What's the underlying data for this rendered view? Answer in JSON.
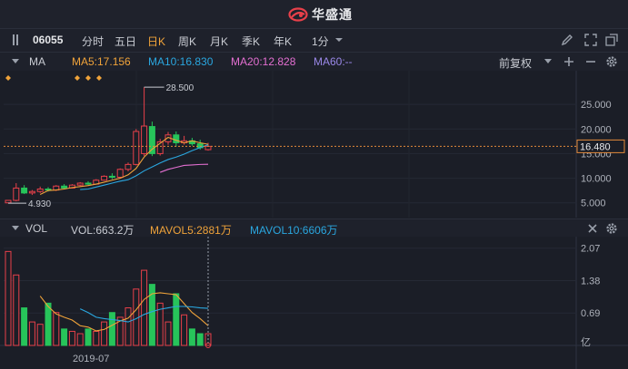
{
  "app": {
    "brand": "华盛通"
  },
  "toolbar": {
    "code": "06055",
    "periods": [
      "分时",
      "五日",
      "日K",
      "周K",
      "月K",
      "季K",
      "年K"
    ],
    "active_period": "日K",
    "interval": "1分"
  },
  "ma_bar": {
    "label": "MA",
    "ma5": "MA5:17.156",
    "ma10": "MA10:16.830",
    "ma20": "MA20:12.828",
    "ma60": "MA60:--",
    "adjust": "前复权",
    "colors": {
      "ma5": "#f0a33a",
      "ma10": "#2aa7e0",
      "ma20": "#e36fd1",
      "ma60": "#9a88e8",
      "up": "#e8404a",
      "down": "#27c45a"
    }
  },
  "price_axis": {
    "ticks": [
      "25.000",
      "20.000",
      "15.000",
      "10.000",
      "5.000"
    ],
    "current_price": "16.480",
    "high_label": "28.500",
    "low_label": "4.930"
  },
  "vol_bar": {
    "label": "VOL",
    "vol": "VOL:663.2万",
    "mavol5": "MAVOL5:2881万",
    "mavol10": "MAVOL10:6606万"
  },
  "vol_axis": {
    "ticks": [
      "2.07",
      "1.38",
      "0.69"
    ],
    "unit": "亿"
  },
  "x_axis": {
    "date_label": "2019-07"
  },
  "chart_data": {
    "type": "candlestick",
    "note_unit": "price HKD, volume 亿",
    "candles": [
      {
        "o": 5.0,
        "h": 5.6,
        "l": 4.93,
        "c": 5.5,
        "v": 2.0
      },
      {
        "o": 5.5,
        "h": 9.0,
        "l": 5.3,
        "c": 8.0,
        "v": 1.5
      },
      {
        "o": 8.0,
        "h": 8.6,
        "l": 6.8,
        "c": 7.0,
        "v": 0.8
      },
      {
        "o": 7.0,
        "h": 7.6,
        "l": 6.6,
        "c": 7.3,
        "v": 0.5
      },
      {
        "o": 7.3,
        "h": 8.3,
        "l": 7.0,
        "c": 7.8,
        "v": 0.45
      },
      {
        "o": 7.8,
        "h": 8.2,
        "l": 7.3,
        "c": 7.6,
        "v": 0.9
      },
      {
        "o": 7.6,
        "h": 8.6,
        "l": 7.4,
        "c": 8.4,
        "v": 0.7
      },
      {
        "o": 8.4,
        "h": 8.8,
        "l": 7.8,
        "c": 8.0,
        "v": 0.35
      },
      {
        "o": 8.0,
        "h": 8.8,
        "l": 7.9,
        "c": 8.6,
        "v": 0.3
      },
      {
        "o": 8.6,
        "h": 9.2,
        "l": 8.4,
        "c": 9.0,
        "v": 0.25
      },
      {
        "o": 9.0,
        "h": 9.4,
        "l": 8.6,
        "c": 8.8,
        "v": 0.35
      },
      {
        "o": 8.8,
        "h": 9.8,
        "l": 8.7,
        "c": 9.6,
        "v": 0.3
      },
      {
        "o": 9.6,
        "h": 10.6,
        "l": 9.5,
        "c": 10.4,
        "v": 0.5
      },
      {
        "o": 10.4,
        "h": 11.0,
        "l": 9.8,
        "c": 10.2,
        "v": 0.7
      },
      {
        "o": 10.2,
        "h": 12.0,
        "l": 10.0,
        "c": 11.8,
        "v": 0.6
      },
      {
        "o": 11.8,
        "h": 13.2,
        "l": 11.4,
        "c": 12.8,
        "v": 0.8
      },
      {
        "o": 12.8,
        "h": 20.0,
        "l": 12.6,
        "c": 19.5,
        "v": 1.2
      },
      {
        "o": 15.0,
        "h": 28.5,
        "l": 14.5,
        "c": 20.6,
        "v": 1.6
      },
      {
        "o": 20.5,
        "h": 21.5,
        "l": 14.5,
        "c": 15.0,
        "v": 1.3
      },
      {
        "o": 15.0,
        "h": 18.0,
        "l": 14.6,
        "c": 17.4,
        "v": 0.9
      },
      {
        "o": 17.4,
        "h": 19.4,
        "l": 16.8,
        "c": 18.8,
        "v": 0.5
      },
      {
        "o": 18.8,
        "h": 19.5,
        "l": 16.4,
        "c": 17.2,
        "v": 1.1
      },
      {
        "o": 17.2,
        "h": 18.6,
        "l": 16.8,
        "c": 17.6,
        "v": 0.65
      },
      {
        "o": 17.6,
        "h": 18.2,
        "l": 16.6,
        "c": 17.0,
        "v": 0.35
      },
      {
        "o": 17.0,
        "h": 17.8,
        "l": 15.8,
        "c": 16.2,
        "v": 0.25
      },
      {
        "o": 15.8,
        "h": 17.2,
        "l": 15.6,
        "c": 16.48,
        "v": 0.25
      }
    ],
    "ma5": [
      null,
      null,
      null,
      null,
      6.7,
      7.5,
      7.6,
      7.8,
      8.1,
      8.3,
      8.5,
      8.8,
      9.2,
      9.6,
      10.0,
      10.7,
      12.0,
      14.3,
      15.9,
      17.1,
      18.3,
      17.7,
      17.2,
      17.6,
      17.2,
      16.9
    ],
    "ma10": [
      null,
      null,
      null,
      null,
      null,
      null,
      null,
      null,
      null,
      7.7,
      7.8,
      8.2,
      8.6,
      9.0,
      9.4,
      9.7,
      10.5,
      11.5,
      12.3,
      13.1,
      13.8,
      14.3,
      14.9,
      15.6,
      16.2,
      16.8
    ],
    "ma20": [
      null,
      null,
      null,
      null,
      null,
      null,
      null,
      null,
      null,
      null,
      null,
      null,
      null,
      null,
      null,
      null,
      null,
      null,
      null,
      11.2,
      11.8,
      12.2,
      12.6,
      12.7,
      12.8,
      12.83
    ],
    "mavol5": [
      null,
      null,
      null,
      null,
      1.05,
      0.83,
      0.67,
      0.6,
      0.54,
      0.42,
      0.39,
      0.31,
      0.34,
      0.43,
      0.52,
      0.58,
      0.76,
      0.98,
      1.1,
      1.12,
      1.1,
      1.08,
      0.89,
      0.7,
      0.57,
      0.42
    ],
    "mavol10": [
      null,
      null,
      null,
      null,
      null,
      null,
      null,
      null,
      null,
      0.78,
      0.7,
      0.6,
      0.57,
      0.55,
      0.53,
      0.5,
      0.57,
      0.66,
      0.72,
      0.77,
      0.8,
      0.83,
      0.83,
      0.82,
      0.8,
      0.79
    ]
  }
}
